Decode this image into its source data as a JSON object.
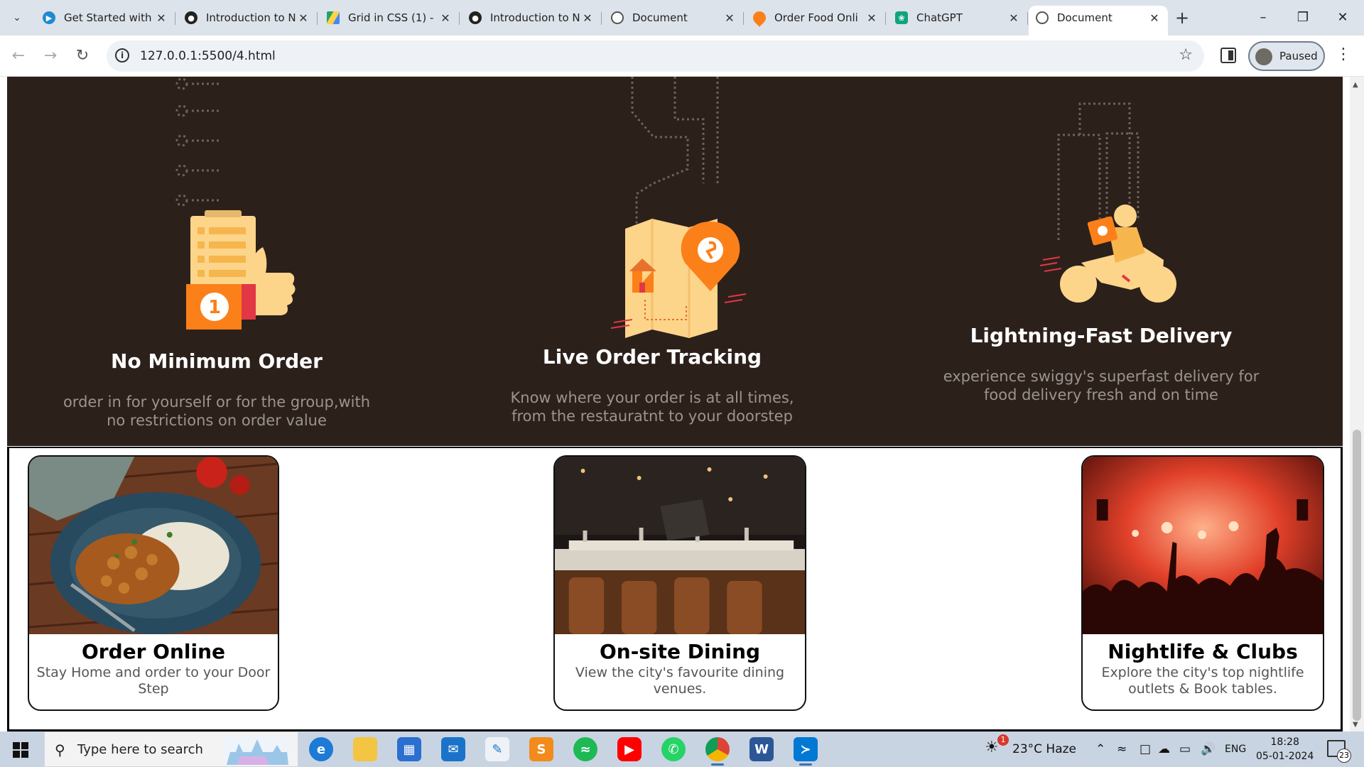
{
  "browser": {
    "tabs": [
      {
        "title": "Get Started with",
        "icon": "vscode-icon",
        "color": "#1f8ad2"
      },
      {
        "title": "Introduction to N",
        "icon": "web-icon",
        "color": "#222222"
      },
      {
        "title": "Grid in CSS (1) - ",
        "icon": "google-drive-icon",
        "color": "#1fa463"
      },
      {
        "title": "Introduction to N",
        "icon": "web-icon",
        "color": "#222222"
      },
      {
        "title": "Document",
        "icon": "globe-icon",
        "color": "#555555"
      },
      {
        "title": "Order Food Onli",
        "icon": "swiggy-icon",
        "color": "#fc8019"
      },
      {
        "title": "ChatGPT",
        "icon": "chatgpt-icon",
        "color": "#10a37f"
      },
      {
        "title": "Document",
        "icon": "globe-icon",
        "color": "#555555",
        "active": true
      }
    ],
    "url": "127.0.0.1:5500/4.html",
    "profile_label": "Paused"
  },
  "features": [
    {
      "title": "No Minimum Order",
      "text": "order in for yourself or for the group,with no restrictions on order value"
    },
    {
      "title": "Live Order Tracking",
      "text": "Know where your order is at all times, from the restauratnt to your doorstep"
    },
    {
      "title": "Lightning-Fast Delivery",
      "text": "experience swiggy's superfast delivery for food delivery fresh and on time"
    }
  ],
  "cards": [
    {
      "title": "Order Online",
      "text": "Stay Home and order to your Door Step"
    },
    {
      "title": "On-site Dining",
      "text": "View the city's favourite dining venues."
    },
    {
      "title": "Nightlife & Clubs",
      "text": "Explore the city's top nightlife outlets & Book tables."
    }
  ],
  "taskbar": {
    "search_placeholder": "Type here to search",
    "weather": "23°C  Haze",
    "weather_badge": "1",
    "language": "ENG",
    "time": "18:28",
    "date": "05-01-2024",
    "notification_count": "23"
  },
  "colors": {
    "dark_bg": "#2c201b",
    "accent_orange": "#fc8019",
    "illustration_yellow": "#fcd58b"
  }
}
